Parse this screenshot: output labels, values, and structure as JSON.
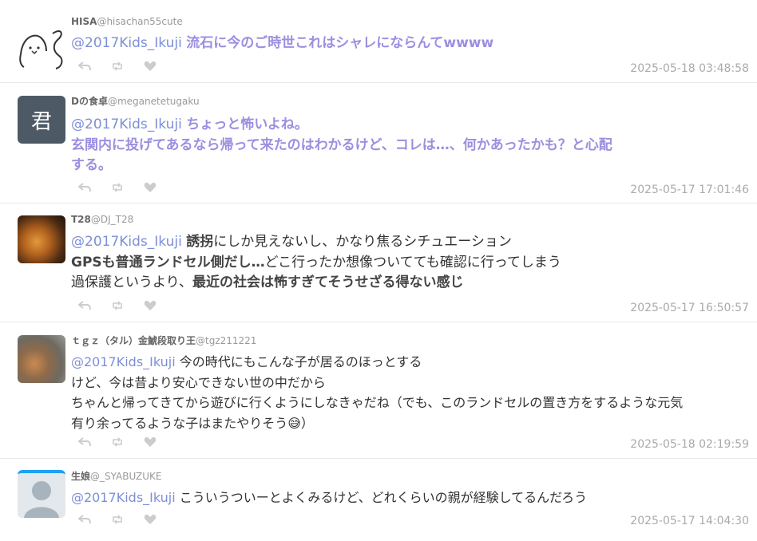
{
  "tweets": [
    {
      "name": "HISA",
      "handle": "@hisachan55cute",
      "mention": "@2017Kids_Ikuji",
      "text": "流石に今のご時世これはシャレにならんてwwww",
      "time": "2025-05-18 03:48:58",
      "avatar_icon": "cartoon-bird-icon"
    },
    {
      "name": "Dの食卓",
      "handle": "@meganetetugaku",
      "mention": "@2017Kids_Ikuji",
      "text_l1": "ちょっと怖いよね。",
      "text_l2": "玄関内に投げてあるなら帰って来たのはわかるけど、コレは…、何かあったかも？と心配",
      "text_l3": "する。",
      "time": "2025-05-17 17:01:46",
      "avatar_text": "君"
    },
    {
      "name": "T28",
      "handle": "@DJ_T28",
      "mention": "@2017Kids_Ikuji",
      "l1_bold": "誘拐",
      "l1_rest": "にしか見えないし、かなり焦るシチュエーション",
      "l2_bold": "GPSも普通ランドセル側だし…",
      "l2_rest": "どこ行ったか想像ついてても確認に行ってしまう",
      "l3_plain": "過保護というより、",
      "l3_bold": "最近の社会は怖すぎてそうせざる得ない感じ",
      "time": "2025-05-17 16:50:57"
    },
    {
      "name": "ｔｇｚ（タル）金鯱段取り王",
      "handle": "@tgz211221",
      "mention": "@2017Kids_Ikuji",
      "l1": "今の時代にもこんな子が居るのほっとする",
      "l2": "けど、今は昔より安心できない世の中だから",
      "l3": "ちゃんと帰ってきてから遊びに行くようにしなきゃだね（でも、このランドセルの置き方をするような元気",
      "l4_text": "有り余ってるような子はまたやりそう",
      "l4_emoji": "😅",
      "l4_end": "）",
      "time": "2025-05-18 02:19:59"
    },
    {
      "name": "生娘",
      "handle": "@_SYABUZUKE",
      "mention": "@2017Kids_Ikuji",
      "text": "こういうついーとよくみるけど、どれくらいの親が経験してるんだろう",
      "time": "2025-05-17 14:04:30",
      "avatar_icon": "default-user-icon"
    }
  ],
  "icons": {
    "reply": "reply-icon",
    "retweet": "retweet-icon",
    "like": "heart-icon"
  },
  "colors": {
    "mention": "#7d8fd8",
    "highlight": "#9b8fe0",
    "timestamp": "#aaaaaa",
    "action": "#cccccc"
  }
}
